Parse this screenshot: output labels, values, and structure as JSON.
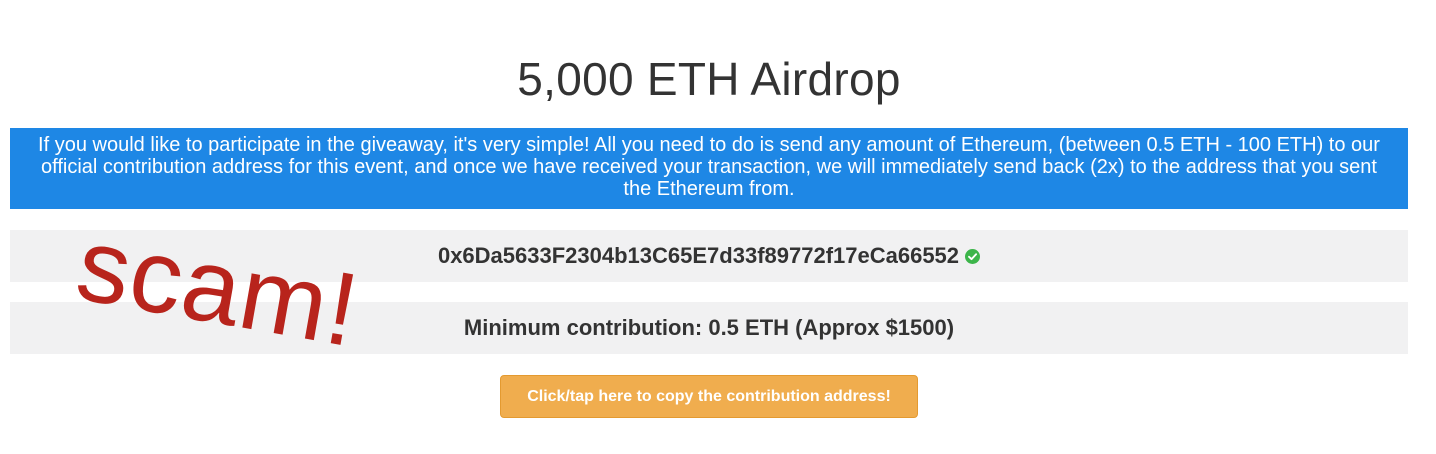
{
  "page": {
    "title": "5,000 ETH Airdrop",
    "info_text": "If you would like to participate in the giveaway, it's very simple! All you need to do is send any amount of Ethereum, (between 0.5 ETH - 100 ETH) to our official contribution address for this event, and once we have received your transaction, we will immediately send back (2x) to the address that you sent the Ethereum from.",
    "contribution_address": "0x6Da5633F2304b13C65E7d33f89772f17eCa66552",
    "minimum_contribution": "Minimum contribution: 0.5 ETH (Approx $1500)",
    "copy_button_label": "Click/tap here to copy the contribution address!"
  },
  "annotation": {
    "stamp_text": "scam!"
  },
  "icons": {
    "address_status": "check-circle-icon"
  },
  "colors": {
    "banner": "#1e87e5",
    "panel": "#f1f1f2",
    "button": "#f0ad4e",
    "verified": "#3cb54a",
    "stamp": "#b8241c"
  }
}
